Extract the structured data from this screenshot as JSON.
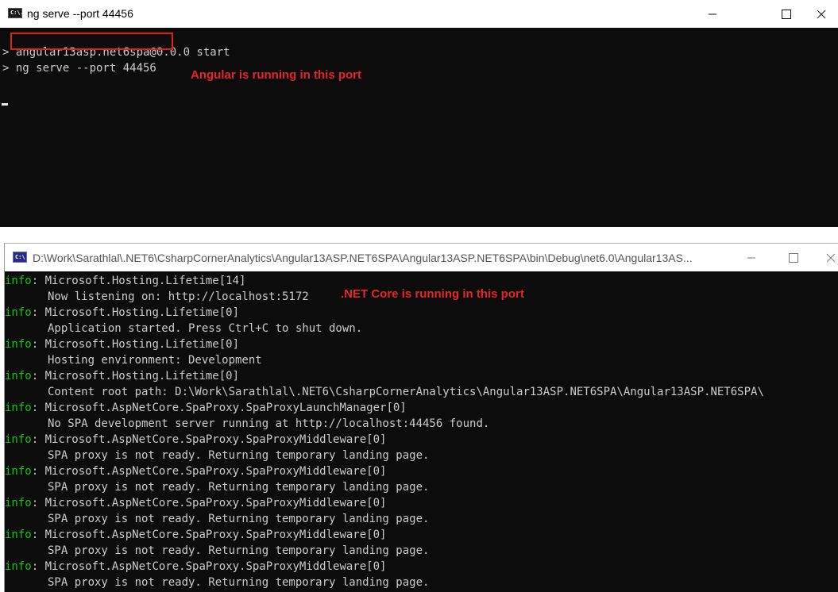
{
  "window1": {
    "title": "ng serve --port 44456",
    "icon": "cmd-icon",
    "icon_text": "C:\\.",
    "controls": {
      "minimize": "—",
      "maximize": "☐",
      "close": "✕"
    },
    "lines": [
      "> angular13asp.net6spa@0.0.0 start",
      "> ng serve --port 44456"
    ],
    "annotation": "Angular is running in this port",
    "annotation_color": "#e8232a"
  },
  "window2": {
    "title": "D:\\Work\\Sarathlal\\.NET6\\CsharpCornerAnalytics\\Angular13ASP.NET6SPA\\Angular13ASP.NET6SPA\\bin\\Debug\\net6.0\\Angular13AS...",
    "icon": "dotnet-console-icon",
    "icon_text": "C:\\",
    "controls": {
      "minimize": "—",
      "maximize": "☐",
      "close": "✕"
    },
    "annotation": ".NET Core is running in this port",
    "annotation_color": "#e8232a",
    "log": [
      {
        "level": "info",
        "source": "Microsoft.Hosting.Lifetime[14]",
        "message": "Now listening on: http://localhost:5172"
      },
      {
        "level": "info",
        "source": "Microsoft.Hosting.Lifetime[0]",
        "message": "Application started. Press Ctrl+C to shut down."
      },
      {
        "level": "info",
        "source": "Microsoft.Hosting.Lifetime[0]",
        "message": "Hosting environment: Development"
      },
      {
        "level": "info",
        "source": "Microsoft.Hosting.Lifetime[0]",
        "message": "Content root path: D:\\Work\\Sarathlal\\.NET6\\CsharpCornerAnalytics\\Angular13ASP.NET6SPA\\Angular13ASP.NET6SPA\\"
      },
      {
        "level": "info",
        "source": "Microsoft.AspNetCore.SpaProxy.SpaProxyLaunchManager[0]",
        "message": "No SPA development server running at http://localhost:44456 found."
      },
      {
        "level": "info",
        "source": "Microsoft.AspNetCore.SpaProxy.SpaProxyMiddleware[0]",
        "message": "SPA proxy is not ready. Returning temporary landing page."
      },
      {
        "level": "info",
        "source": "Microsoft.AspNetCore.SpaProxy.SpaProxyMiddleware[0]",
        "message": "SPA proxy is not ready. Returning temporary landing page."
      },
      {
        "level": "info",
        "source": "Microsoft.AspNetCore.SpaProxy.SpaProxyMiddleware[0]",
        "message": "SPA proxy is not ready. Returning temporary landing page."
      },
      {
        "level": "info",
        "source": "Microsoft.AspNetCore.SpaProxy.SpaProxyMiddleware[0]",
        "message": "SPA proxy is not ready. Returning temporary landing page."
      },
      {
        "level": "info",
        "source": "Microsoft.AspNetCore.SpaProxy.SpaProxyMiddleware[0]",
        "message": "SPA proxy is not ready. Returning temporary landing page."
      }
    ]
  },
  "colors": {
    "terminal_bg": "#0c0c0c",
    "terminal_fg": "#cccccc",
    "info_green": "#16c60c",
    "highlight_red": "#e02020"
  }
}
